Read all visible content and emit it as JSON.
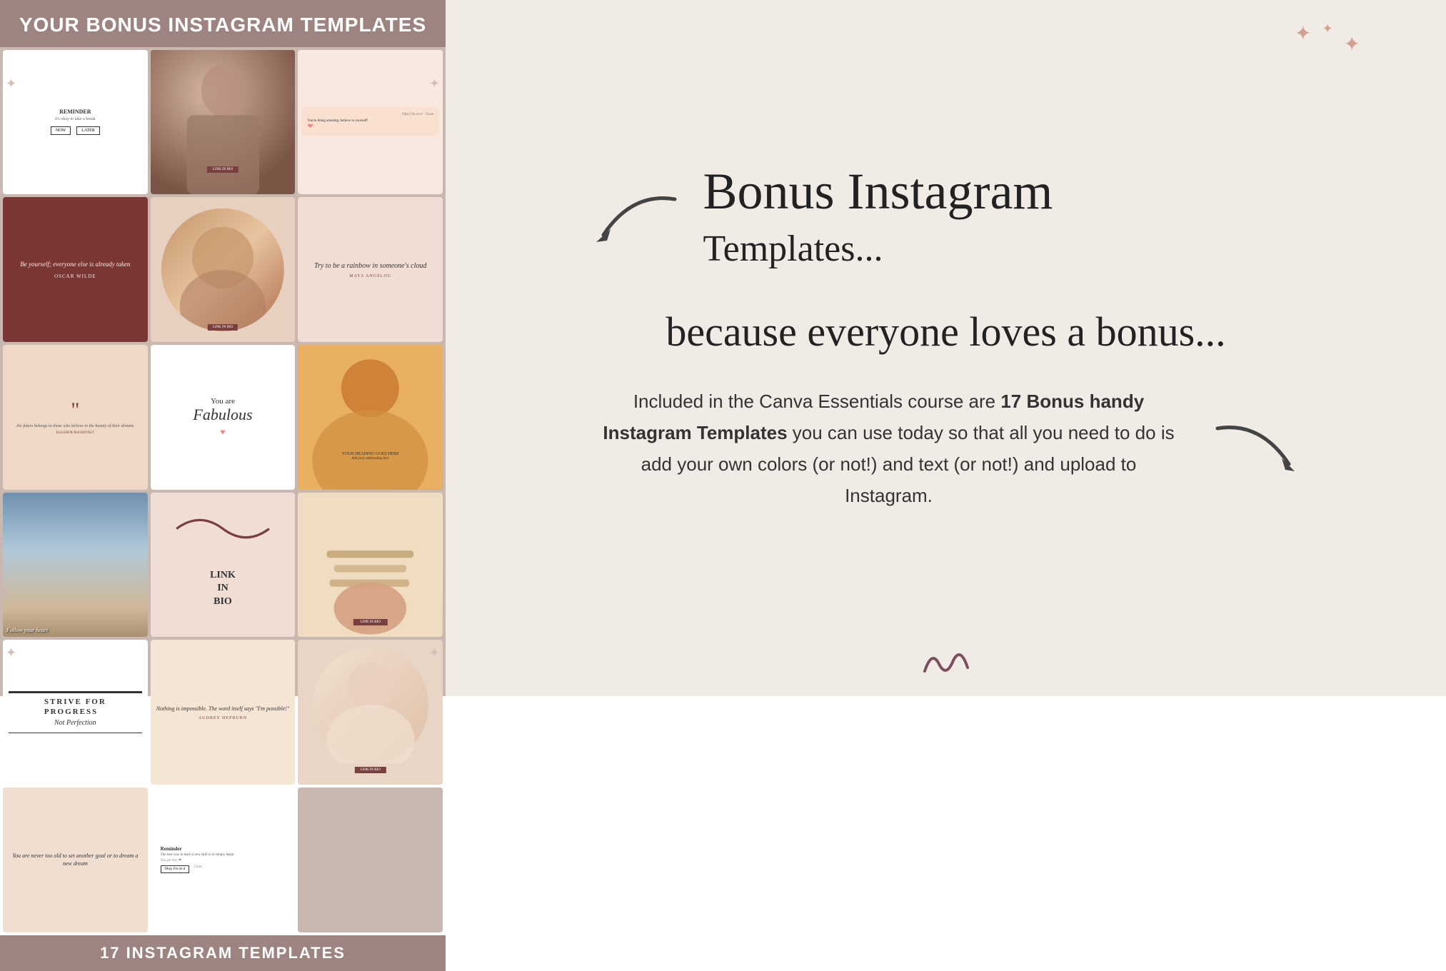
{
  "left": {
    "header": "YOUR BONUS INSTAGRAM TEMPLATES",
    "footer": "17 INSTAGRAM TEMPLATES",
    "cards": [
      {
        "id": "reminder",
        "type": "reminder"
      },
      {
        "id": "photo-woman",
        "type": "photo-woman"
      },
      {
        "id": "okay-close",
        "type": "okay-close"
      },
      {
        "id": "quote-wilde",
        "type": "quote-wilde",
        "quote": "Be yourself; everyone else is already taken",
        "author": "OSCAR WILDE"
      },
      {
        "id": "circle-woman",
        "type": "circle-woman"
      },
      {
        "id": "rainbow",
        "type": "rainbow",
        "text": "Try to be a rainbow in someone's cloud",
        "author": "MAYA ANGELOU"
      },
      {
        "id": "quotemark",
        "type": "quotemark",
        "text": "the future belongs to those who believe in the beauty of their dreams",
        "author": "ELEANOR ROOSEVELT"
      },
      {
        "id": "fabulous",
        "type": "fabulous",
        "top": "You are",
        "main": "Fabulous"
      },
      {
        "id": "woman-yellow",
        "type": "woman-yellow"
      },
      {
        "id": "landscape",
        "type": "landscape",
        "text": "Follow your heart"
      },
      {
        "id": "link-bio",
        "type": "link-bio",
        "text": "LINK\nIN\nBIO"
      },
      {
        "id": "books",
        "type": "books"
      },
      {
        "id": "strive",
        "type": "strive",
        "top": "STRIVE FOR\nPROGRESS",
        "bottom": "Not Perfection"
      },
      {
        "id": "impossible",
        "type": "impossible",
        "text": "Nothing is impossible. The word itself says \"I'm possible!\"",
        "author": "AUDREY HEPBURN"
      },
      {
        "id": "woman-circle",
        "type": "woman-circle"
      },
      {
        "id": "never-old",
        "type": "never-old",
        "text": "You are never too old to set another goal or to dream a new dream"
      },
      {
        "id": "reminder2",
        "type": "reminder2",
        "title": "Reminder",
        "text": "The best way to learn a new skill is to simply begin.",
        "sub": "You got this ❤"
      }
    ]
  },
  "right": {
    "title_line1": "Bonus Instagram",
    "title_line2": "Templates...",
    "bonus_text": "because everyone loves a bonus...",
    "body": "Included in the Canva Essentials course are ",
    "bold_part": "17 Bonus handy Instagram Templates",
    "body2": " you can use today so that all you need to do is add your own colors (or not!) and text (or not!) and upload to Instagram.",
    "vertical_text": "17 instagram templates!",
    "sparkles": [
      "✦",
      "✦",
      "✦"
    ],
    "arrow_label": "↙"
  }
}
